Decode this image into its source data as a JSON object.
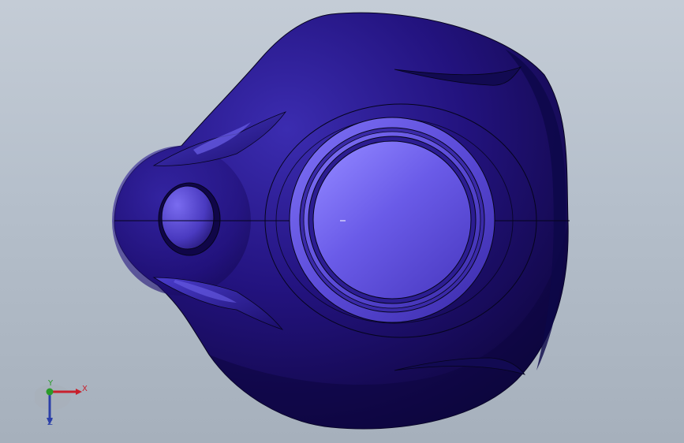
{
  "viewport": {
    "background_top": "#c4ccd6",
    "background_bottom": "#a6b0bc"
  },
  "model": {
    "body_color": "#23137f",
    "highlight_color": "#7a6cf0",
    "edge_color": "#05041c"
  },
  "triad": {
    "x_label": "X",
    "y_label": "Y",
    "z_label": "Z",
    "x_color": "#c8202c",
    "y_color": "#2a9b2a",
    "z_color": "#2b3fa8"
  }
}
